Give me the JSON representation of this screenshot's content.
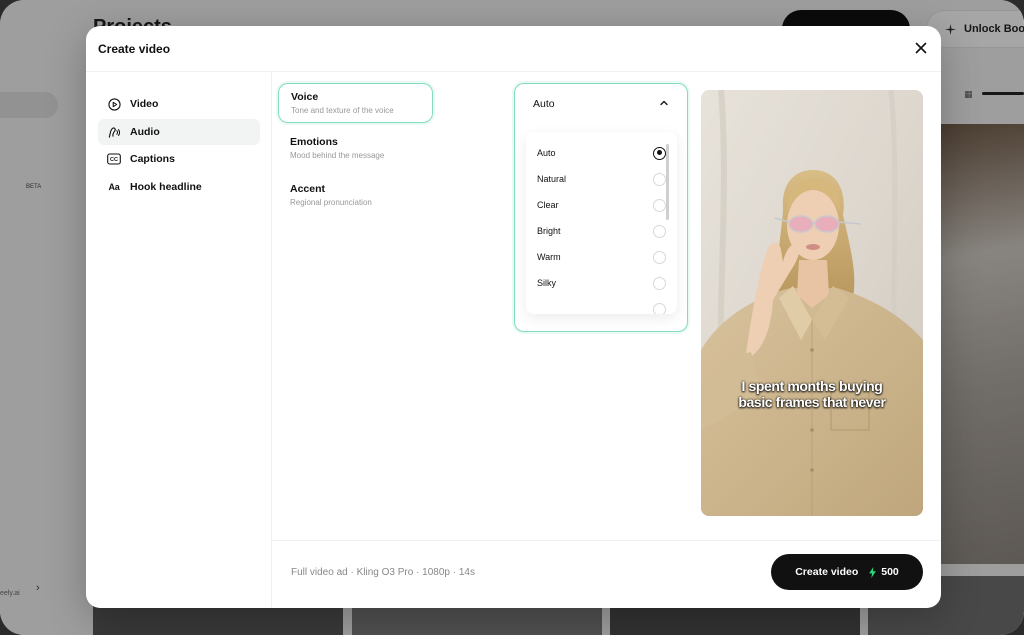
{
  "background": {
    "page_title": "Projects",
    "boost_label": "Unlock Boos",
    "beta_label": "BETA",
    "url_text": "eely.ai"
  },
  "modal": {
    "title": "Create video",
    "nav": [
      {
        "label": "Video",
        "icon": "play-circle-icon"
      },
      {
        "label": "Audio",
        "icon": "audio-wave-icon",
        "active": true
      },
      {
        "label": "Captions",
        "icon": "cc-icon"
      },
      {
        "label": "Hook headline",
        "icon": "aa-icon",
        "icon_text": "Aa"
      }
    ],
    "options": [
      {
        "label": "Voice",
        "description": "Tone and texture of the voice",
        "active": true
      },
      {
        "label": "Emotions",
        "description": "Mood behind the message"
      },
      {
        "label": "Accent",
        "description": "Regional pronunciation"
      }
    ],
    "dropdown": {
      "selected": "Auto",
      "items": [
        "Auto",
        "Natural",
        "Clear",
        "Bright",
        "Warm",
        "Silky"
      ]
    },
    "preview": {
      "caption_line1": "I spent months buying",
      "caption_line2": "basic frames that never"
    },
    "footer": {
      "info": "Full video ad · Kling O3 Pro · 1080p · 14s",
      "create_label": "Create video",
      "credits": "500"
    }
  },
  "colors": {
    "accent_teal": "#84dcbe",
    "bolt_green": "#2bd97a",
    "button_dark": "#111111"
  }
}
